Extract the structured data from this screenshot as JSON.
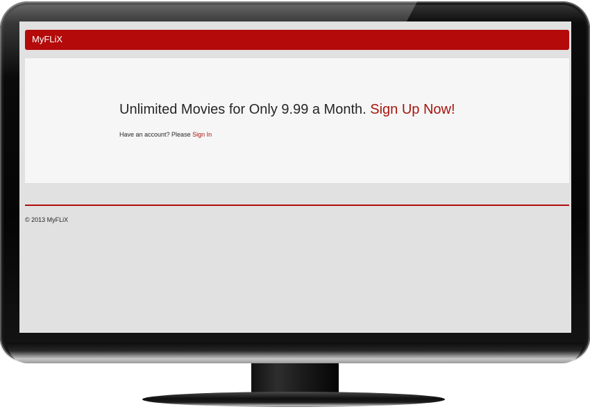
{
  "navbar": {
    "brand": "MyFLiX"
  },
  "hero": {
    "headline": "Unlimited Movies for Only 9.99 a Month.",
    "signup_link": "Sign Up Now!",
    "account_prompt": "Have an account? Please",
    "signin_link": "Sign In"
  },
  "footer": {
    "copyright": "© 2013 MyFLiX"
  },
  "colors": {
    "brand_red": "#b40a0a",
    "link_red": "#a8140e",
    "screen_bg": "#e1e1e1",
    "hero_bg": "#f6f6f6"
  }
}
